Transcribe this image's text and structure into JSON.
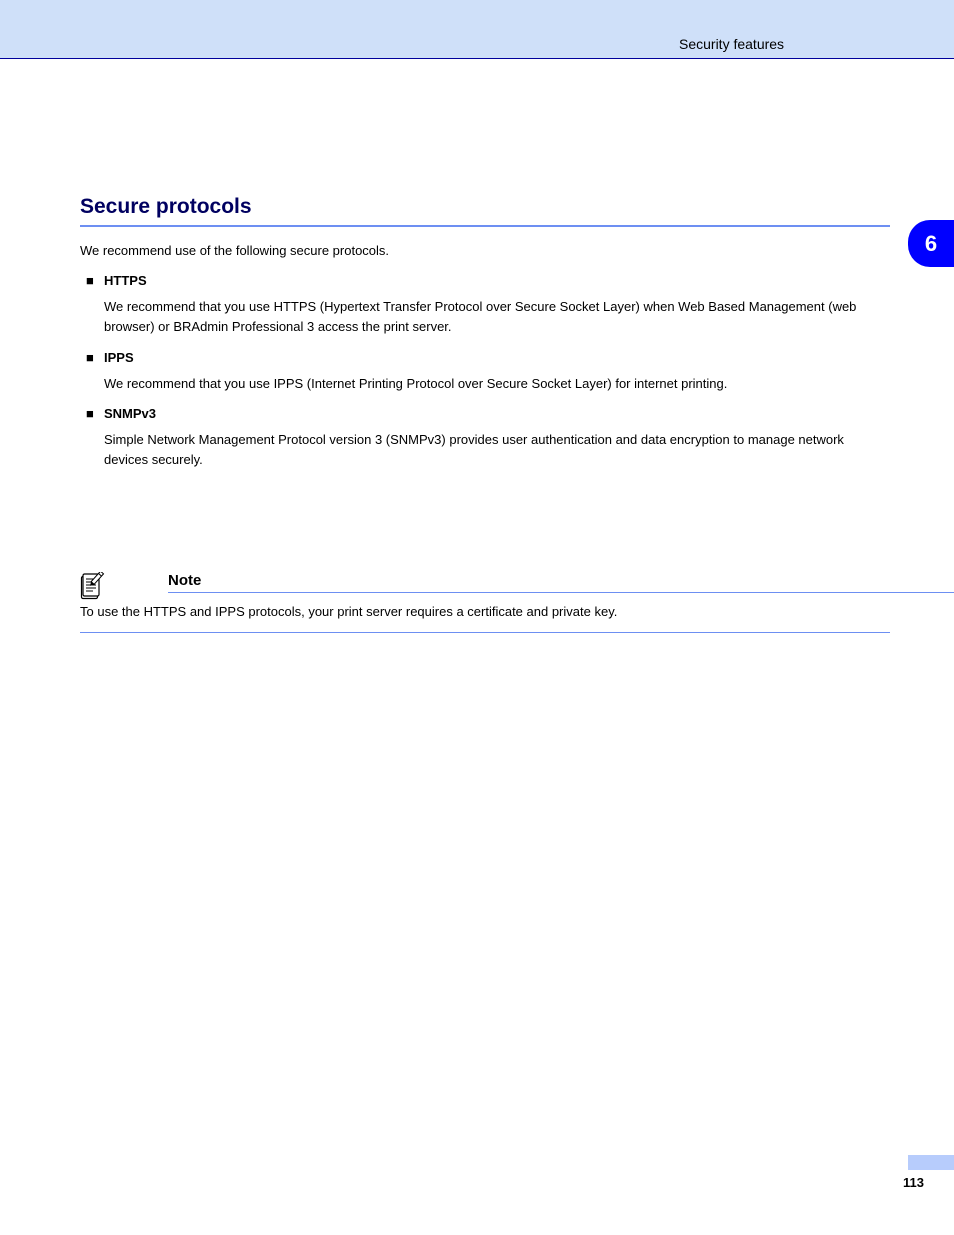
{
  "header": {
    "breadcrumb": "Security features"
  },
  "side_tab": "6",
  "section": {
    "heading": "Secure protocols",
    "intro": "We recommend use of the following secure protocols.",
    "bullets": [
      {
        "title": "HTTPS",
        "body": "We recommend that you use HTTPS (Hypertext Transfer Protocol over Secure Socket Layer) when Web Based Management (web browser) or BRAdmin Professional 3 access the print server."
      },
      {
        "title": "IPPS",
        "body": "We recommend that you use IPPS (Internet Printing Protocol over Secure Socket Layer) for internet printing."
      },
      {
        "title": "SNMPv3",
        "body": "Simple Network Management Protocol version 3 (SNMPv3) provides user authentication and data encryption to manage network devices securely."
      }
    ]
  },
  "note": {
    "label": "Note",
    "text": "To use the HTTPS and IPPS protocols, your print server requires a certificate and private key."
  },
  "page_number": "113"
}
